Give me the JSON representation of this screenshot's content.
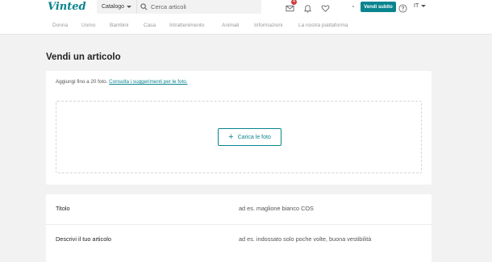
{
  "header": {
    "logo": "Vinted",
    "catalog_label": "Catalogo",
    "search_placeholder": "Cerca articoli",
    "inbox_badge": "4",
    "sell_button": "Vendi subito",
    "language": "IT"
  },
  "nav": {
    "categories": [
      "Donna",
      "Uomo",
      "Bambini",
      "Casa",
      "Intrattenimento",
      "Animali",
      "Informazioni",
      "La nostra piattaforma"
    ]
  },
  "page": {
    "title": "Vendi un articolo"
  },
  "photos": {
    "hint_text": "Aggiungi fino a 20 foto.",
    "hint_link": "Consulta i suggerimenti per le foto.",
    "upload_button": "Carica le foto"
  },
  "fields": {
    "title_label": "Titolo",
    "title_placeholder": "ad es. maglione bianco COS",
    "description_label": "Descrivi il tuo articolo",
    "description_placeholder": "ad es. indossato solo poche volte, buona vestibilità"
  },
  "colors": {
    "accent": "#09848f",
    "background": "#f2f2f2",
    "badge": "#cc3c3c"
  }
}
